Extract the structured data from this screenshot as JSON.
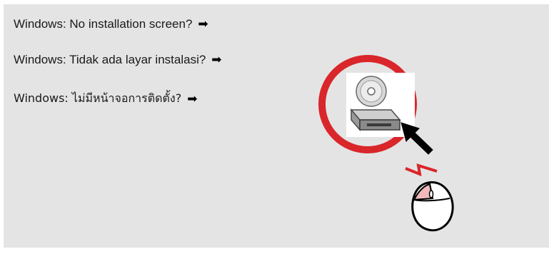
{
  "instructions": {
    "english": "Windows: No installation screen?",
    "indonesian": "Windows: Tidak ada layar instalasi?",
    "thai": "Windows: ไม่มีหน้าจอการติดตั้ง?"
  },
  "icons": {
    "arrow": "arrow-right-icon",
    "drive": "cd-drive-icon",
    "pointer": "mouse-pointer-icon",
    "mouse": "mouse-icon",
    "double_click": "double-click-zigzag-icon"
  },
  "colors": {
    "panel_background": "#e4e4e4",
    "highlight_ring": "#d9262a",
    "text": "#1a1a1a"
  }
}
